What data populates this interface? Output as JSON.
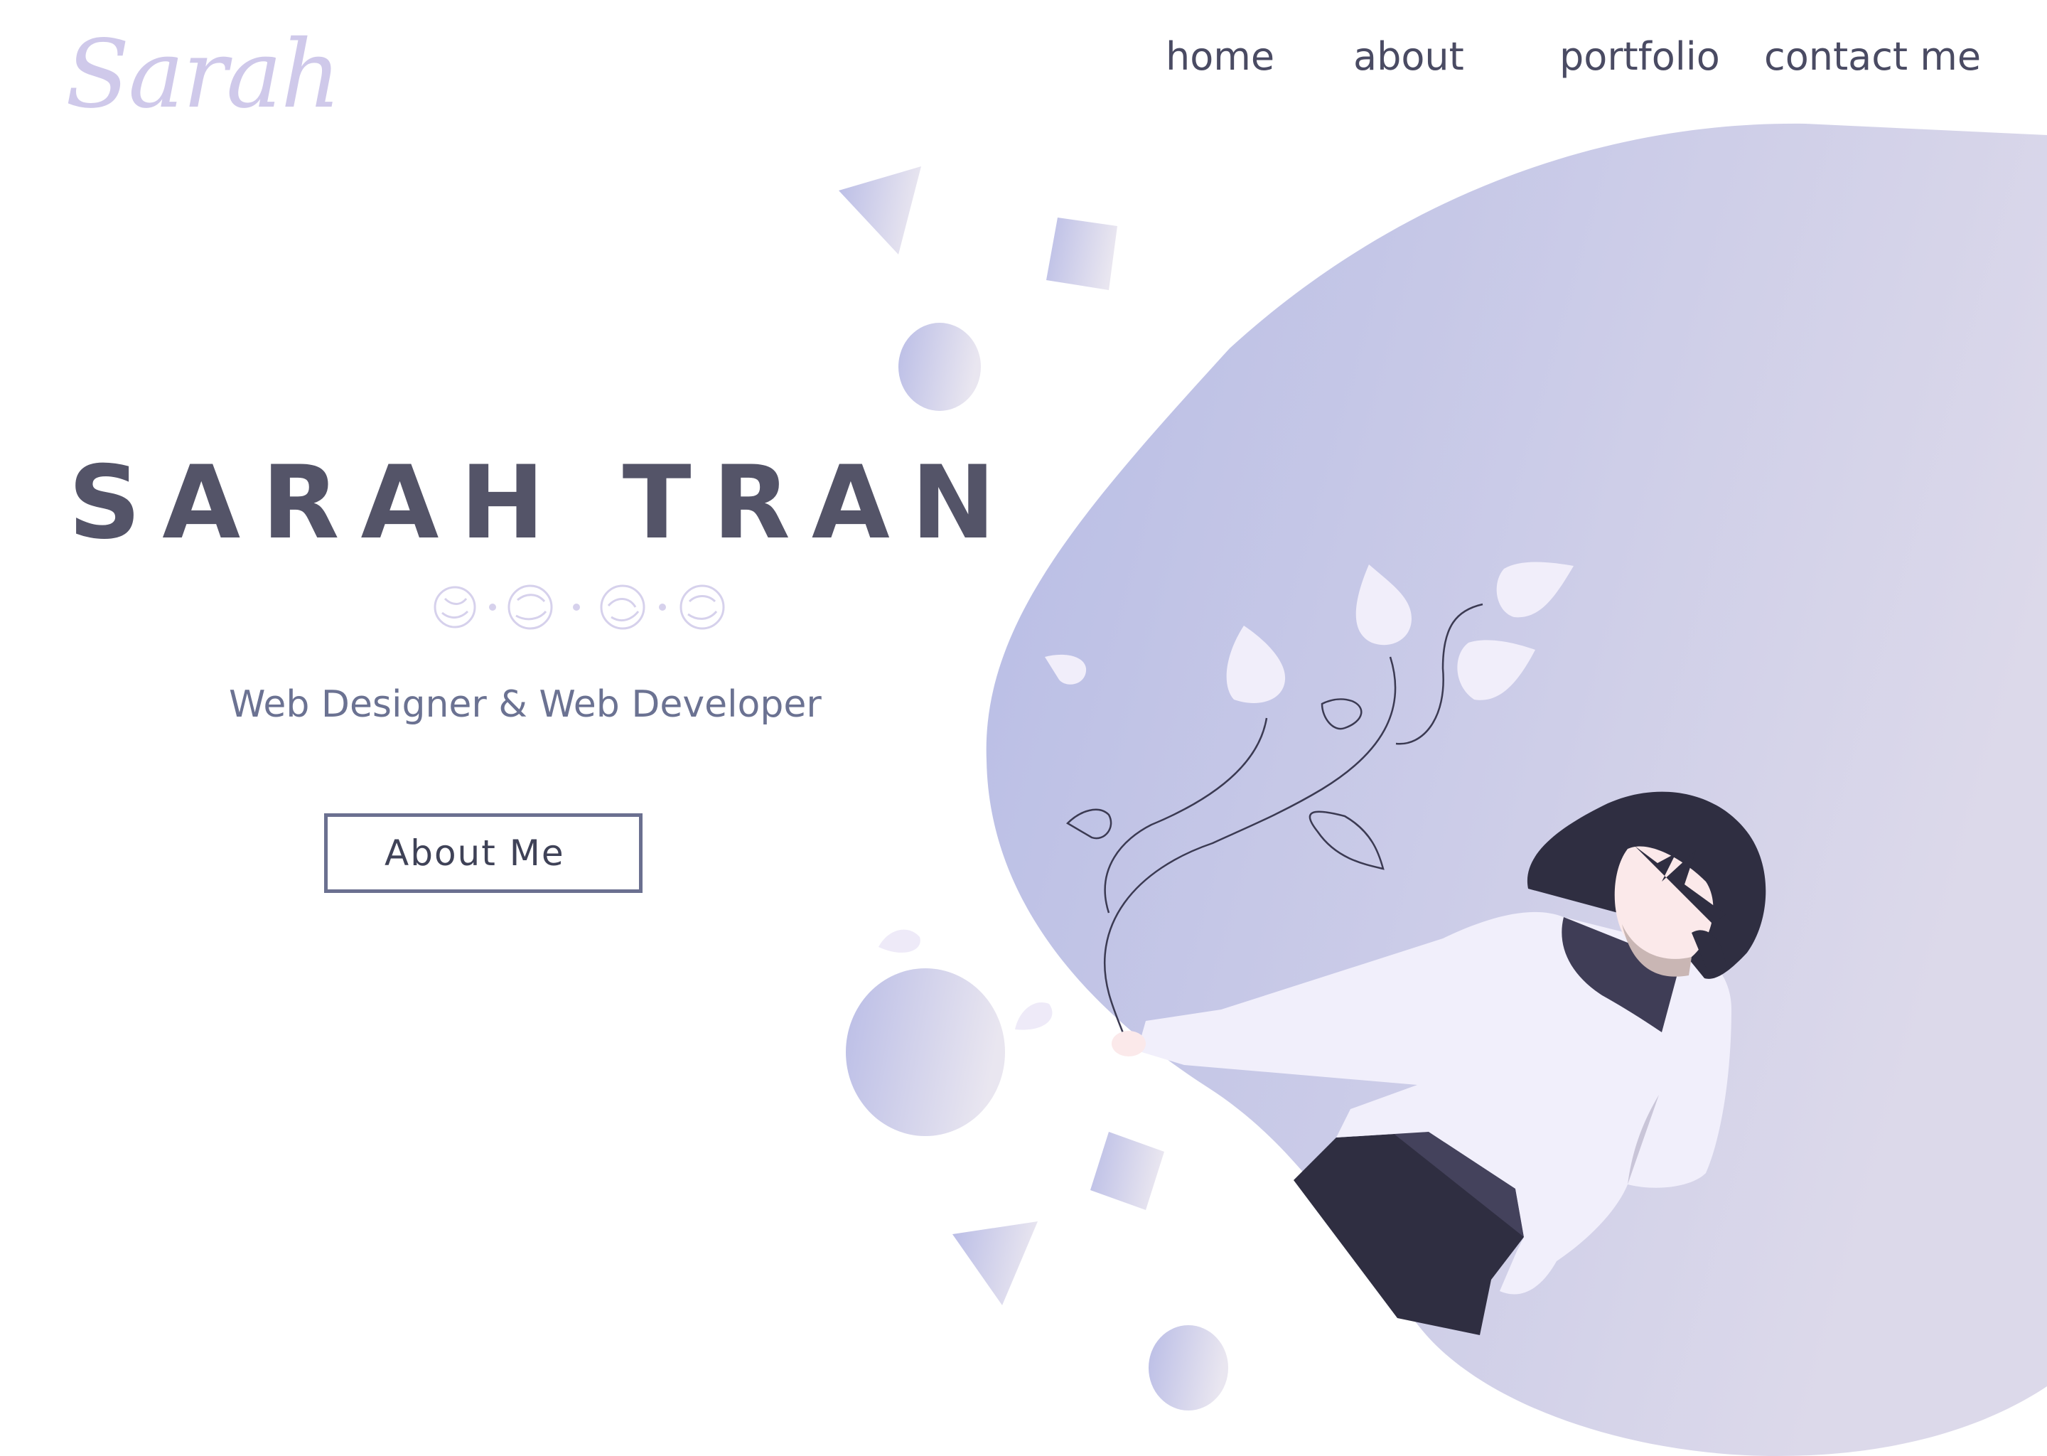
{
  "brand": {
    "logo_text": "Sarah"
  },
  "nav": {
    "items": [
      "home",
      "about",
      "portfolio",
      "contact me"
    ]
  },
  "hero": {
    "name": "SARAH TRAN",
    "subtitle": "Web Designer & Web Developer",
    "cta_label": "About Me"
  },
  "colors": {
    "accent": "#b9bce4",
    "text_dark": "#545468",
    "text_muted": "#6b7292",
    "logo": "#cfc9ea",
    "blob_start": "#b7bce5",
    "blob_end": "#dcd9ea",
    "hair_dark": "#2f2e41",
    "sweater": "#f1effb"
  },
  "illustration": {
    "subject": "girl-with-floating-leaves",
    "decorations": [
      "triangle",
      "square",
      "circle"
    ]
  }
}
